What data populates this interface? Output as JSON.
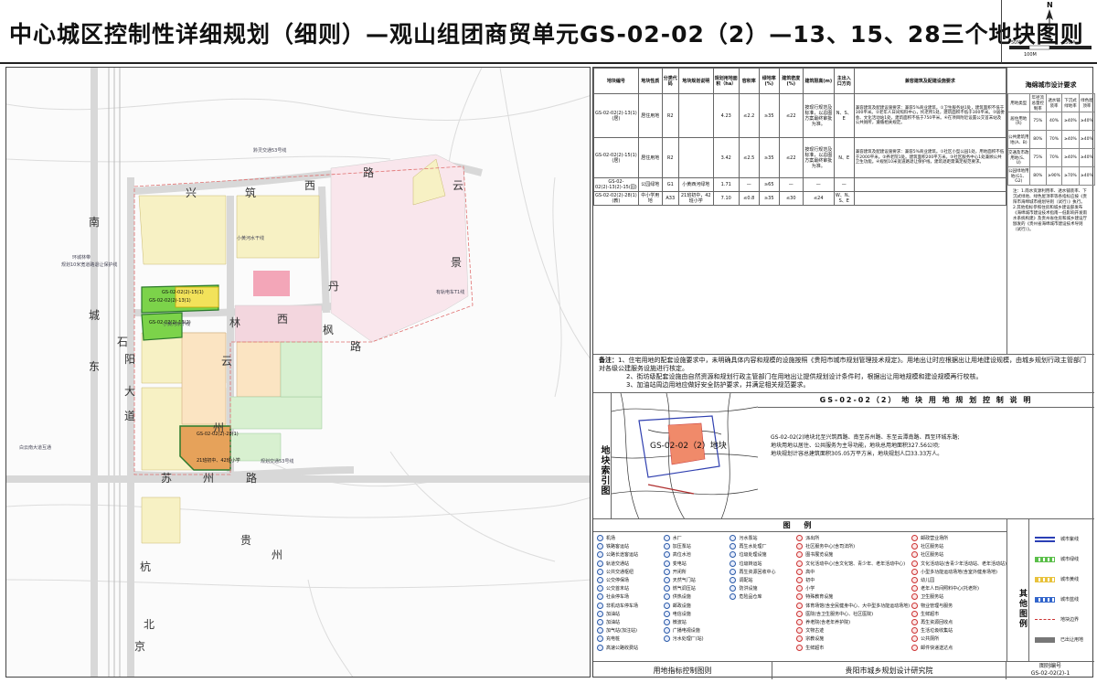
{
  "title": "中心城区控制性详细规划（细则）—观山组团商贸单元GS-02-02（2）—13、15、28三个地块图则",
  "north": {
    "letter": "N",
    "scale_a": "50M",
    "scale_b": "250M",
    "scale_c": "100M"
  },
  "map": {
    "roads": [
      {
        "id": "xing",
        "text": "兴"
      },
      {
        "id": "zhu",
        "text": "筑"
      },
      {
        "id": "xi1",
        "text": "西"
      },
      {
        "id": "lu1",
        "text": "路"
      },
      {
        "id": "yun1",
        "text": "云"
      },
      {
        "id": "jing",
        "text": "景"
      },
      {
        "id": "dan",
        "text": "丹"
      },
      {
        "id": "shi",
        "text": "石"
      },
      {
        "id": "lin",
        "text": "林"
      },
      {
        "id": "xi2",
        "text": "西"
      },
      {
        "id": "lu2",
        "text": "路"
      },
      {
        "id": "feng",
        "text": "枫"
      },
      {
        "id": "yang",
        "text": "阳"
      },
      {
        "id": "yun2",
        "text": "云"
      },
      {
        "id": "dong",
        "text": "东"
      },
      {
        "id": "da",
        "text": "大"
      },
      {
        "id": "dao",
        "text": "道"
      },
      {
        "id": "zhou1",
        "text": "州"
      },
      {
        "id": "su",
        "text": "苏"
      },
      {
        "id": "zhou2",
        "text": "州"
      },
      {
        "id": "lu3",
        "text": "路"
      },
      {
        "id": "cheng",
        "text": "城"
      },
      {
        "id": "nan",
        "text": "南"
      },
      {
        "id": "gui",
        "text": "贵"
      },
      {
        "id": "zhou3",
        "text": "州"
      },
      {
        "id": "hang",
        "text": "杭"
      },
      {
        "id": "bei",
        "text": "北"
      },
      {
        "id": "jing2",
        "text": "京"
      }
    ],
    "plots": [
      {
        "code": "GS-02-02(2)-15(1)",
        "use": "居住用地"
      },
      {
        "code": "GS-02-02(2)-13(1)",
        "use": "居住用地"
      },
      {
        "code": "GS-02-02(2)-13(2)",
        "use": "公园绿地"
      },
      {
        "code": "GS-02-02(2)-28(1)",
        "use": "中小学用地",
        "sub": "21班初中、42班小学"
      }
    ],
    "notes": [
      "规划10米宽道路退让保护线",
      "环城林带",
      "黔灵交通53号线",
      "规划交通53号线",
      "小黄河水干线",
      "有轨电车T1线",
      "白云南大道互通",
      "小黄河水干线"
    ]
  },
  "table": {
    "headers": [
      "地块编号",
      "地块性质",
      "分类代码",
      "地块规划说明",
      "规划用地面积（ha）",
      "容积率",
      "绿地率(%)",
      "建筑密度(%)",
      "建筑限高(m)",
      "主出入口方向",
      "兼容建筑及配建设施要求"
    ],
    "rows": [
      [
        "GS-02-02(2)-13(1)(居)",
        "居住用地",
        "R2",
        "",
        "4.23",
        "≤2.2",
        "≥35",
        "≤22",
        "按现行规范及标准，以总图方案最终审批为准。",
        "N、S、E",
        "兼容建筑及配建设施要求：兼容5%商业建筑。①卫生服务站1处，建筑面积不低于300平米。②老年人日间照料中心，托老所1处，建筑面积不低于300平米。③居委会、文化活动站1处，建筑面积不低于750平米。④在项目附近设置公交首末站及公共厕所，遵循相关规定。"
      ],
      [
        "GS-02-02(2)-15(1)(居)",
        "居住用地",
        "R2",
        "",
        "3.42",
        "≤2.5",
        "≥35",
        "≤22",
        "按现行规范及标准，以总图方案最终审批为准。",
        "N、E",
        "兼容建筑及配建设施要求：兼容5%商业建筑。①社区小型公园1处，用地面积不低于2000平米。②养老院1处。建筑面积200平方米。③社区服务中心1处兼顾公共卫生功能。④规划10米宽道路退让保护线，建筑退距需满足规范要求。"
      ],
      [
        "GS-02-02(2)-13(2)-15(园)",
        "公园绿地",
        "G1",
        "小黄西河绿地",
        "1.71",
        "—",
        "≥65",
        "—",
        "—",
        "—",
        ""
      ],
      [
        "GS-02-02(2)-28(1)(教)",
        "中小学用地",
        "A33",
        "21班初中，42班小学",
        "7.10",
        "≤0.8",
        "≥35",
        "≤30",
        "≤24",
        "W、N、S、E",
        ""
      ]
    ]
  },
  "ocean": {
    "title": "海绵城市设计要求",
    "headers": [
      "用地类型",
      "年径流总量控制率",
      "透水铺装率",
      "下沉式绿地率",
      "绿色屋顶率"
    ],
    "rows": [
      [
        "居住用地(R)",
        "75%",
        "40%",
        "≥40%",
        "≥40%"
      ],
      [
        "公共建筑用地(A、B)",
        "80%",
        "70%",
        "≥40%",
        "≥40%"
      ],
      [
        "交通及市政用地(S、U)",
        "75%",
        "70%",
        "≥40%",
        "≥40%"
      ],
      [
        "公园绿地用地(G1、G2)",
        "80%",
        "≥90%",
        "≥70%",
        "≥40%"
      ]
    ],
    "notes": "注：1.雨水资源利用率、透水铺装率、下沉式绿地、绿色屋顶率等各指标应按《贵阳市海绵城市规划导则（试行）》执行。2.其他指标参照住房和城乡建设部发布《海绵城市建设技术指南—低影响开发雨水系统构建》及贵州省住房和城乡建设厅颁发的《贵州省海绵城市建设技术导则（试行）》。"
  },
  "notes": {
    "label": "备注：",
    "lines": [
      "1、住宅用地的配套设施要求中，未明确具体内容和规模的设施按照《贵阳市城市规划管理技术规定》。用地出让时应根据出让用地建设规模，由城乡规划行政主管部门对各级公建服务设施进行核定。",
      "2、街坊级配套设施由自然资源和规划行政主管部门在用地出让提供规划设计条件时，根据出让用地规模和建设规模再行校核。",
      "3、加油站周边用地应做好安全防护要求，并满足相关规范要求。"
    ]
  },
  "locator": {
    "label": "地块索引图",
    "tag": "GS-02-02（2）地块"
  },
  "explain": {
    "title": "GS-02-02（2） 地 块 用 地 规 划 控 制 说 明",
    "body": [
      "GS-02-02(2)地块北至兴筑西路、南至苏州路、东至云潭南路、西至环城东路;",
      "地块用地以居住、公共服务为主导功能，地块总用地面积327.56公顷;",
      "地块规划计容总建筑面积305.05万平方米，地块规划人口33.33万人。"
    ]
  },
  "legend": {
    "title": "图 例",
    "columns": [
      [
        "机场",
        "铁路客运站",
        "公路长途客运站",
        "轨道交通站",
        "公共交通枢纽",
        "公交停保场",
        "公交首末站",
        "社会停车场",
        "非机动车停车场",
        "加油站",
        "加油站",
        "加气站(加注站)",
        "充电桩",
        "高速公路收费站"
      ],
      [
        "水厂",
        "加压泵站",
        "高位水池",
        "变电站",
        "开闭所",
        "天然气门站",
        "燃气调压站",
        "供热设施",
        "邮政设施",
        "电信设施",
        "微波站",
        "广播电视设施",
        "污水处理厂(站)"
      ],
      [
        "污水泵站",
        "再生水处理厂",
        "垃圾处理设施",
        "垃圾转运站",
        "再生资源回收中心",
        "调配站",
        "防洪设施",
        "危险品仓库"
      ],
      [
        "派出所",
        "社区服务中心(含司法所)",
        "图书展览设施",
        "文化活动中心(含文化馆、青少年、老年活动中心)",
        "高中",
        "初中",
        "小学",
        "特殊教育设施",
        "体育场馆(含全民健身中心、大中型多功能运动场地)",
        "医院(含卫生服务中心、社区医院)",
        "养老院(含老年养护院)",
        "文物古迹",
        "宗教设施",
        "生鲜超市"
      ],
      [
        "邮政营业场所",
        "社区服务站",
        "社区服务站",
        "文化活动站(含青少年活动站、老年活动站)",
        "小型多功能运动场地(含室外健身场地)",
        "幼儿园",
        "老年人日间照料中心(托老所)",
        "卫生服务站",
        "物业管理与服务",
        "生鲜超市",
        "再生资源回收点",
        "生活垃圾收集站",
        "公共厕所",
        "邮件快递送达点"
      ]
    ]
  },
  "other_legend": {
    "label": "其他图例",
    "items": [
      {
        "text": "城市紫线",
        "color": "#2b3fb5"
      },
      {
        "text": "城市绿线",
        "color": "#5bbf4a"
      },
      {
        "text": "城市黄线",
        "color": "#e8c23c"
      },
      {
        "text": "城市蓝线",
        "color": "#3366cc"
      },
      {
        "text": "地块边界",
        "color": "#cc3333"
      },
      {
        "text": "已出让用地",
        "color": "#777777"
      }
    ]
  },
  "bottom": {
    "left": "用地指标控制图则",
    "mid": "贵阳市城乡规划设计研究院",
    "right_a": "图则编号",
    "right_b": "GS-02-02(2)-1"
  }
}
